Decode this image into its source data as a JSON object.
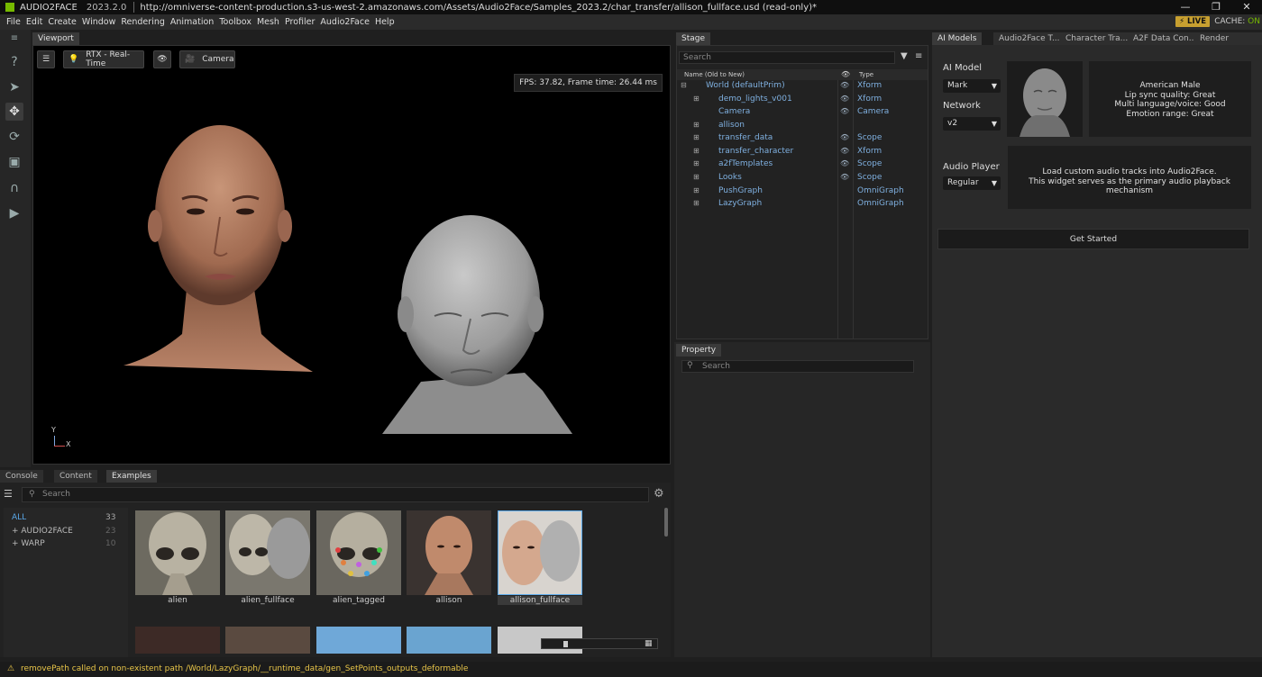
{
  "title": {
    "app": "AUDIO2FACE",
    "version": "2023.2.0",
    "path": "http://omniverse-content-production.s3-us-west-2.amazonaws.com/Assets/Audio2Face/Samples_2023.2/char_transfer/allison_fullface.usd (read-only)*"
  },
  "menu": [
    "File",
    "Edit",
    "Create",
    "Window",
    "Rendering",
    "Animation",
    "Toolbox",
    "Mesh",
    "Profiler",
    "Audio2Face",
    "Help"
  ],
  "live_label": "LIVE",
  "cache": {
    "label": "CACHE:",
    "value": "ON"
  },
  "viewport": {
    "tab": "Viewport",
    "render_mode": "RTX - Real-Time",
    "camera": "Camera",
    "fps": "FPS: 37.82, Frame time: 26.44 ms",
    "axis_y": "Y",
    "axis_x": "X"
  },
  "stage": {
    "tab": "Stage",
    "search_placeholder": "Search",
    "col_name": "Name (Old to New)",
    "col_type": "Type",
    "rows": [
      {
        "name": "World (defaultPrim)",
        "type": "Xform"
      },
      {
        "name": "demo_lights_v001",
        "type": "Xform"
      },
      {
        "name": "Camera",
        "type": "Camera"
      },
      {
        "name": "allison",
        "type": ""
      },
      {
        "name": "transfer_data",
        "type": "Scope"
      },
      {
        "name": "transfer_character",
        "type": "Xform"
      },
      {
        "name": "a2fTemplates",
        "type": "Scope"
      },
      {
        "name": "Looks",
        "type": "Scope"
      },
      {
        "name": "PushGraph",
        "type": "OmniGraph"
      },
      {
        "name": "LazyGraph",
        "type": "OmniGraph"
      }
    ]
  },
  "property": {
    "tab": "Property",
    "search_placeholder": "Search"
  },
  "right_tabs": [
    "AI Models",
    "Audio2Face T...",
    "Character Tra...",
    "A2F Data Con...",
    "Render Settin..."
  ],
  "ai": {
    "model_label": "AI Model",
    "model_value": "Mark",
    "network_label": "Network",
    "network_value": "v2",
    "model_info": [
      "American Male",
      "Lip sync quality: Great",
      "Multi language/voice: Good",
      "Emotion range: Great"
    ],
    "player_label": "Audio Player",
    "player_value": "Regular",
    "player_info": [
      "Load custom audio tracks into Audio2Face.",
      "This widget serves as the primary audio playback mechanism"
    ],
    "get_started": "Get Started"
  },
  "bottom": {
    "tabs": [
      "Console",
      "Content",
      "Examples"
    ],
    "search_placeholder": "Search",
    "categories": [
      {
        "name": "ALL",
        "count": "33"
      },
      {
        "name": "+ AUDIO2FACE",
        "count": "23"
      },
      {
        "name": "+ WARP",
        "count": "10"
      }
    ],
    "thumbs": [
      "alien",
      "alien_fullface",
      "alien_tagged",
      "allison",
      "allison_fullface"
    ]
  },
  "status_message": "removePath called on non-existent path /World/LazyGraph/__runtime_data/gen_SetPoints_outputs_deformable"
}
